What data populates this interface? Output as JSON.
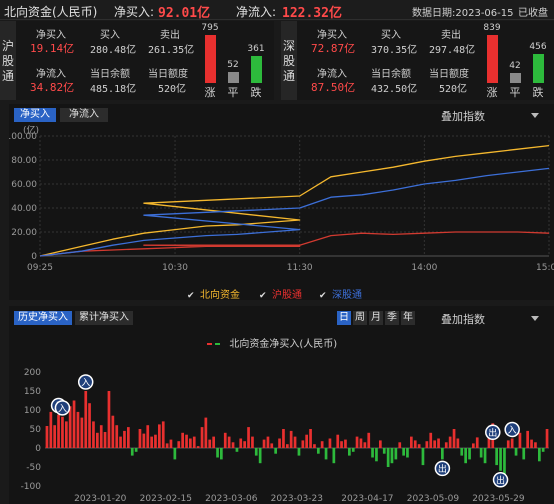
{
  "header": {
    "title": "北向资金(人民币)",
    "net_buy_label": "净买入:",
    "net_buy_value": "92.01亿",
    "net_inflow_label": "净流入:",
    "net_inflow_value": "122.32亿",
    "date_label": "数据日期:2023-06-15",
    "status": "已收盘"
  },
  "sh_connect": {
    "label": "沪股通",
    "net_buy_label": "净买入",
    "net_buy_value": "19.14亿",
    "buy_label": "买入",
    "buy_value": "280.48亿",
    "sell_label": "卖出",
    "sell_value": "261.35亿",
    "net_inflow_label": "净流入",
    "net_inflow_value": "34.82亿",
    "balance_label": "当日余额",
    "balance_value": "485.18亿",
    "quota_label": "当日额度",
    "quota_value": "520亿",
    "up_count": 795,
    "flat_count": 52,
    "down_count": 361,
    "up_label": "涨",
    "flat_label": "平",
    "down_label": "跌"
  },
  "sz_connect": {
    "label": "深股通",
    "net_buy_label": "净买入",
    "net_buy_value": "72.87亿",
    "buy_label": "买入",
    "buy_value": "370.35亿",
    "sell_label": "卖出",
    "sell_value": "297.48亿",
    "net_inflow_label": "净流入",
    "net_inflow_value": "87.50亿",
    "balance_label": "当日余额",
    "balance_value": "432.50亿",
    "quota_label": "当日额度",
    "quota_value": "520亿",
    "up_count": 839,
    "flat_count": 42,
    "down_count": 456,
    "up_label": "涨",
    "flat_label": "平",
    "down_label": "跌"
  },
  "intraday": {
    "tabs": [
      "净买入",
      "净流入"
    ],
    "overlay_label": "叠加指数",
    "legend": [
      "北向资金",
      "沪股通",
      "深股通"
    ]
  },
  "history": {
    "tabs": [
      "历史净买入",
      "累计净买入"
    ],
    "periods": [
      "日",
      "周",
      "月",
      "季",
      "年"
    ],
    "overlay_label": "叠加指数",
    "legend": "北向资金净买入(人民币)",
    "marker_in": "入",
    "marker_out": "出"
  },
  "colors": {
    "up": "#e8302f",
    "down": "#2dba3c",
    "north": "#f5b82e",
    "sh": "#d13a30",
    "sz": "#3c6fd8",
    "accent": "#2a63c5"
  },
  "chart_data": [
    {
      "type": "line",
      "unit_label": "(亿)",
      "ylim": [
        0,
        100
      ],
      "y_ticks": [
        "100.00",
        "80.00",
        "60.00",
        "40.00",
        "20.00",
        "0"
      ],
      "x_ticks": [
        "09:25",
        "10:30",
        "11:30",
        "14:00",
        "15:00"
      ],
      "x": [
        "09:25",
        "09:45",
        "10:00",
        "10:15",
        "10:30",
        "10:45",
        "11:00",
        "11:15",
        "11:30",
        "11:45",
        "13:00",
        "13:15",
        "13:30",
        "13:45",
        "14:00",
        "14:15",
        "14:30",
        "14:45",
        "15:00"
      ],
      "series": [
        {
          "name": "北向资金",
          "values": [
            0,
            8,
            14,
            19,
            22,
            25,
            26,
            28,
            30,
            44,
            50,
            66,
            70,
            74,
            79,
            83,
            86,
            89,
            92
          ]
        },
        {
          "name": "沪股通",
          "values": [
            0,
            4,
            5,
            6,
            7,
            8,
            8,
            8,
            8,
            9,
            9,
            17,
            19,
            18,
            19,
            20,
            20,
            20,
            19
          ]
        },
        {
          "name": "深股通",
          "values": [
            0,
            4,
            9,
            13,
            15,
            17,
            18,
            20,
            22,
            34,
            40,
            49,
            51,
            55,
            60,
            63,
            67,
            70,
            73
          ]
        }
      ],
      "grid": true,
      "legend_position": "bottom"
    },
    {
      "type": "bar",
      "ylim": [
        -100,
        200
      ],
      "y_ticks": [
        "200",
        "150",
        "100",
        "50",
        "0",
        "-50",
        "-100"
      ],
      "x_ticks": [
        "2023-01-20",
        "2023-02-15",
        "2023-03-06",
        "2023-03-23",
        "2023-04-17",
        "2023-05-09",
        "2023-05-29"
      ],
      "series": [
        {
          "name": "北向资金净买入(人民币)",
          "values": [
            58,
            95,
            60,
            88,
            82,
            70,
            110,
            125,
            95,
            80,
            150,
            118,
            70,
            40,
            60,
            42,
            150,
            85,
            60,
            30,
            45,
            55,
            -20,
            -10,
            50,
            38,
            60,
            30,
            35,
            62,
            70,
            12,
            22,
            -30,
            18,
            40,
            35,
            25,
            30,
            5,
            55,
            80,
            22,
            30,
            -25,
            -30,
            40,
            30,
            15,
            -10,
            25,
            18,
            55,
            30,
            -20,
            -40,
            22,
            30,
            12,
            -15,
            25,
            50,
            10,
            45,
            30,
            -20,
            20,
            35,
            50,
            10,
            -15,
            18,
            -30,
            25,
            -40,
            35,
            18,
            22,
            -20,
            -10,
            30,
            25,
            15,
            40,
            -25,
            -35,
            20,
            -15,
            -50,
            -40,
            -30,
            15,
            -20,
            -25,
            30,
            20,
            10,
            -45,
            18,
            40,
            20,
            25,
            -30,
            15,
            30,
            50,
            25,
            -20,
            -40,
            -30,
            12,
            28,
            -25,
            -40,
            30,
            65,
            -45,
            -60,
            -70,
            20,
            25,
            -20,
            40,
            -30,
            45,
            22,
            15,
            -35,
            -10,
            50
          ]
        }
      ]
    }
  ]
}
